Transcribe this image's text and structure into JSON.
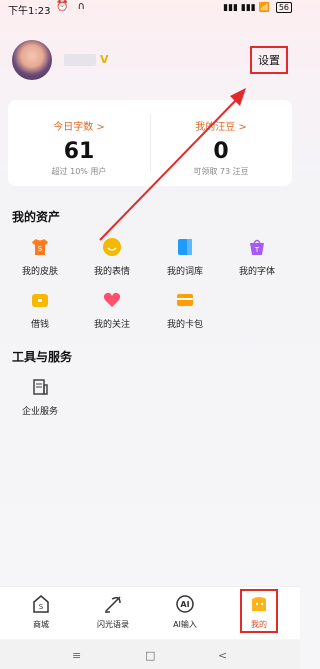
{
  "status_bar": {
    "time": "下午1:23",
    "icons": "⏰ ∩",
    "signal": "▮▮▮ ▮▮▮ 📶",
    "battery": "56"
  },
  "profile": {
    "settings_label": "设置"
  },
  "stats": {
    "left": {
      "label": "今日字数 >",
      "value": "61",
      "sub": "超过 10% 用户"
    },
    "right": {
      "label": "我的汪豆 >",
      "value": "0",
      "sub": "可领取 73 汪豆"
    }
  },
  "assets": {
    "title": "我的资产",
    "items": [
      {
        "label": "我的皮肤",
        "icon": "shirt-icon",
        "color": "#ff7a1a"
      },
      {
        "label": "我的表情",
        "icon": "smile-icon",
        "color": "#f5b800"
      },
      {
        "label": "我的词库",
        "icon": "book-icon",
        "color": "#1e9bff"
      },
      {
        "label": "我的字体",
        "icon": "font-icon",
        "color": "#a55cf0"
      },
      {
        "label": "借钱",
        "icon": "wallet-icon",
        "color": "#f6b800"
      },
      {
        "label": "我的关注",
        "icon": "heart-icon",
        "color": "#ff4f6d"
      },
      {
        "label": "我的卡包",
        "icon": "card-icon",
        "color": "#ffa000"
      }
    ]
  },
  "tools": {
    "title": "工具与服务",
    "items": [
      {
        "label": "企业服务",
        "icon": "enterprise-icon"
      }
    ]
  },
  "bottom_nav": [
    {
      "label": "商城",
      "icon": "shop-icon"
    },
    {
      "label": "闪光语录",
      "icon": "quote-icon"
    },
    {
      "label": "AI输入",
      "icon": "ai-icon"
    },
    {
      "label": "我的",
      "icon": "me-icon",
      "active": true
    }
  ],
  "system_nav": {
    "menu": "≡",
    "home": "□",
    "back": "<"
  }
}
